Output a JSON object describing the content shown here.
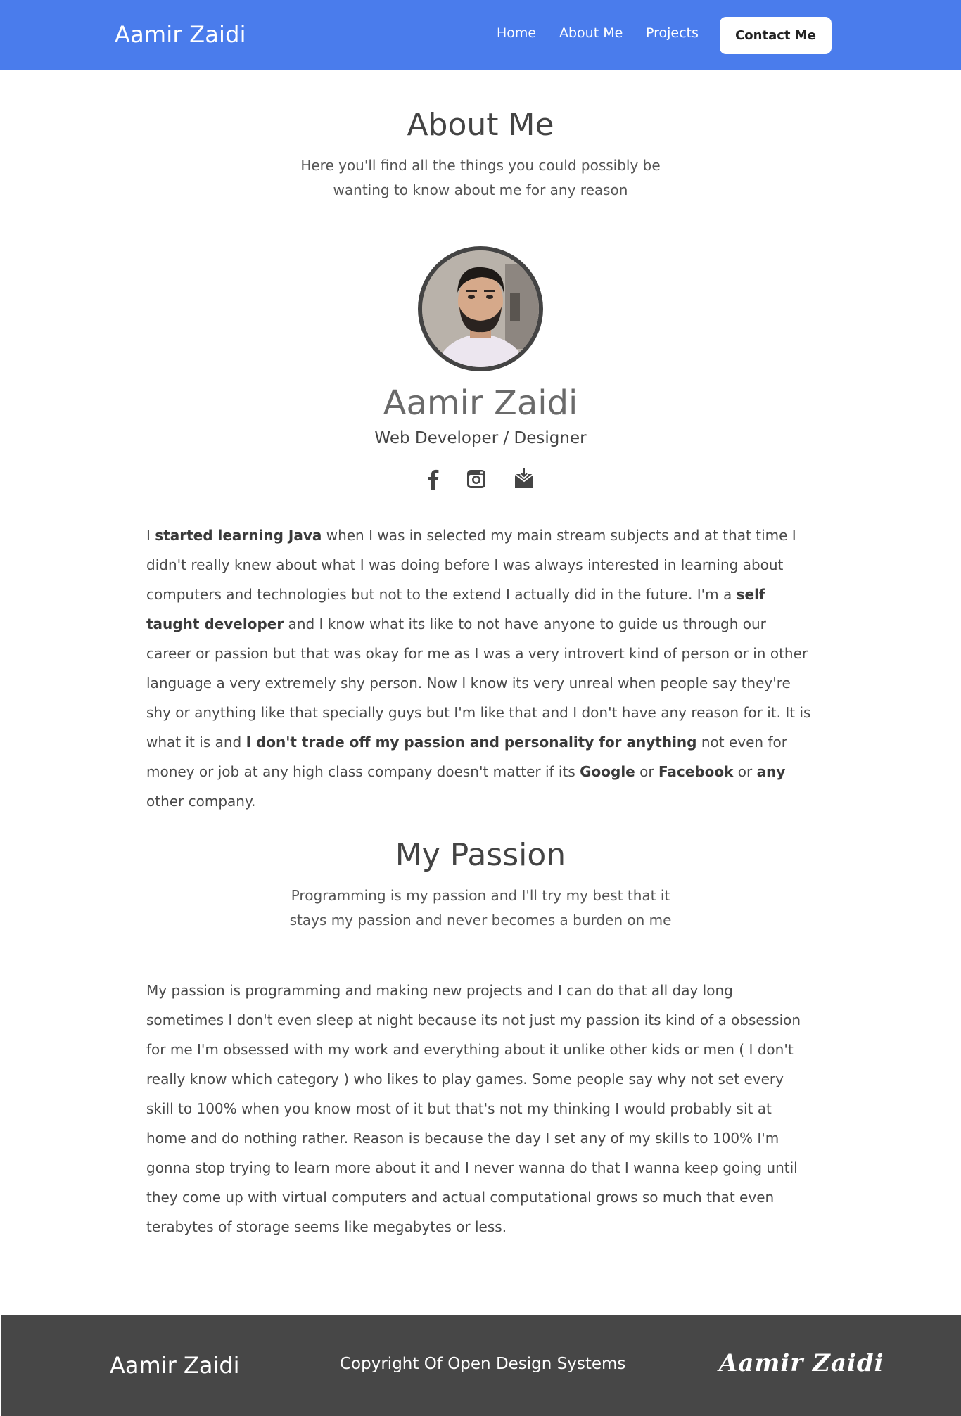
{
  "header": {
    "brand": "Aamir Zaidi",
    "nav": [
      "Home",
      "About Me",
      "Projects"
    ],
    "contact_label": "Contact Me"
  },
  "about": {
    "title": "About Me",
    "subtitle": "Here you'll find all the things you could possibly be wanting to know about me for any reason"
  },
  "profile": {
    "name": "Aamir Zaidi",
    "role": "Web Developer / Designer",
    "social_icons": [
      "facebook-icon",
      "instagram-icon",
      "mail-icon"
    ]
  },
  "about_paragraph": [
    {
      "text": "I ",
      "bold": false
    },
    {
      "text": "started learning Java",
      "bold": true
    },
    {
      "text": " when I was in selected my main stream subjects and at that time I didn't really knew about what I was doing before I was always interested in learning about computers and technologies but not to the extend I actually did in the future. I'm a ",
      "bold": false
    },
    {
      "text": "self taught developer",
      "bold": true
    },
    {
      "text": " and I know what its like to not have anyone to guide us through our career or passion but that was okay for me as I was a very introvert kind of person or in other language a very extremely shy person. Now I know its very unreal when people say they're shy or anything like that specially guys but I'm like that and I don't have any reason for it. It is what it is and ",
      "bold": false
    },
    {
      "text": "I don't trade off my passion and personality for anything",
      "bold": true
    },
    {
      "text": " not even for money or job at any high class company doesn't matter if its ",
      "bold": false
    },
    {
      "text": "Google",
      "bold": true
    },
    {
      "text": " or ",
      "bold": false
    },
    {
      "text": "Facebook",
      "bold": true
    },
    {
      "text": " or ",
      "bold": false
    },
    {
      "text": "any",
      "bold": true
    },
    {
      "text": " other company.",
      "bold": false
    }
  ],
  "passion": {
    "title": "My Passion",
    "subtitle": "Programming is my passion and I'll try my best that it stays my passion and never becomes a burden on me",
    "paragraph": "My passion is programming and making new projects and I can do that all day long sometimes I don't even sleep at night because its not just my passion its kind of a obsession for me I'm obsessed with my work and everything about it unlike other kids or men ( I don't really know which category ) who likes to play games. Some people say why not set every skill to 100% when you know most of it but that's not my thinking I would probably sit at home and do nothing rather. Reason is because the day I set any of my skills to 100% I'm gonna stop trying to learn more about it and I never wanna do that I wanna keep going until they come up with virtual computers and actual computational grows so much that even terabytes of storage seems like megabytes or less."
  },
  "footer": {
    "brand": "Aamir Zaidi",
    "copyright": "Copyright Of Open Design Systems",
    "signature": "Aamir Zaidi"
  },
  "colors": {
    "nav_bg": "#4a7cec",
    "footer_bg": "#474747",
    "text": "#4a4a4a"
  }
}
